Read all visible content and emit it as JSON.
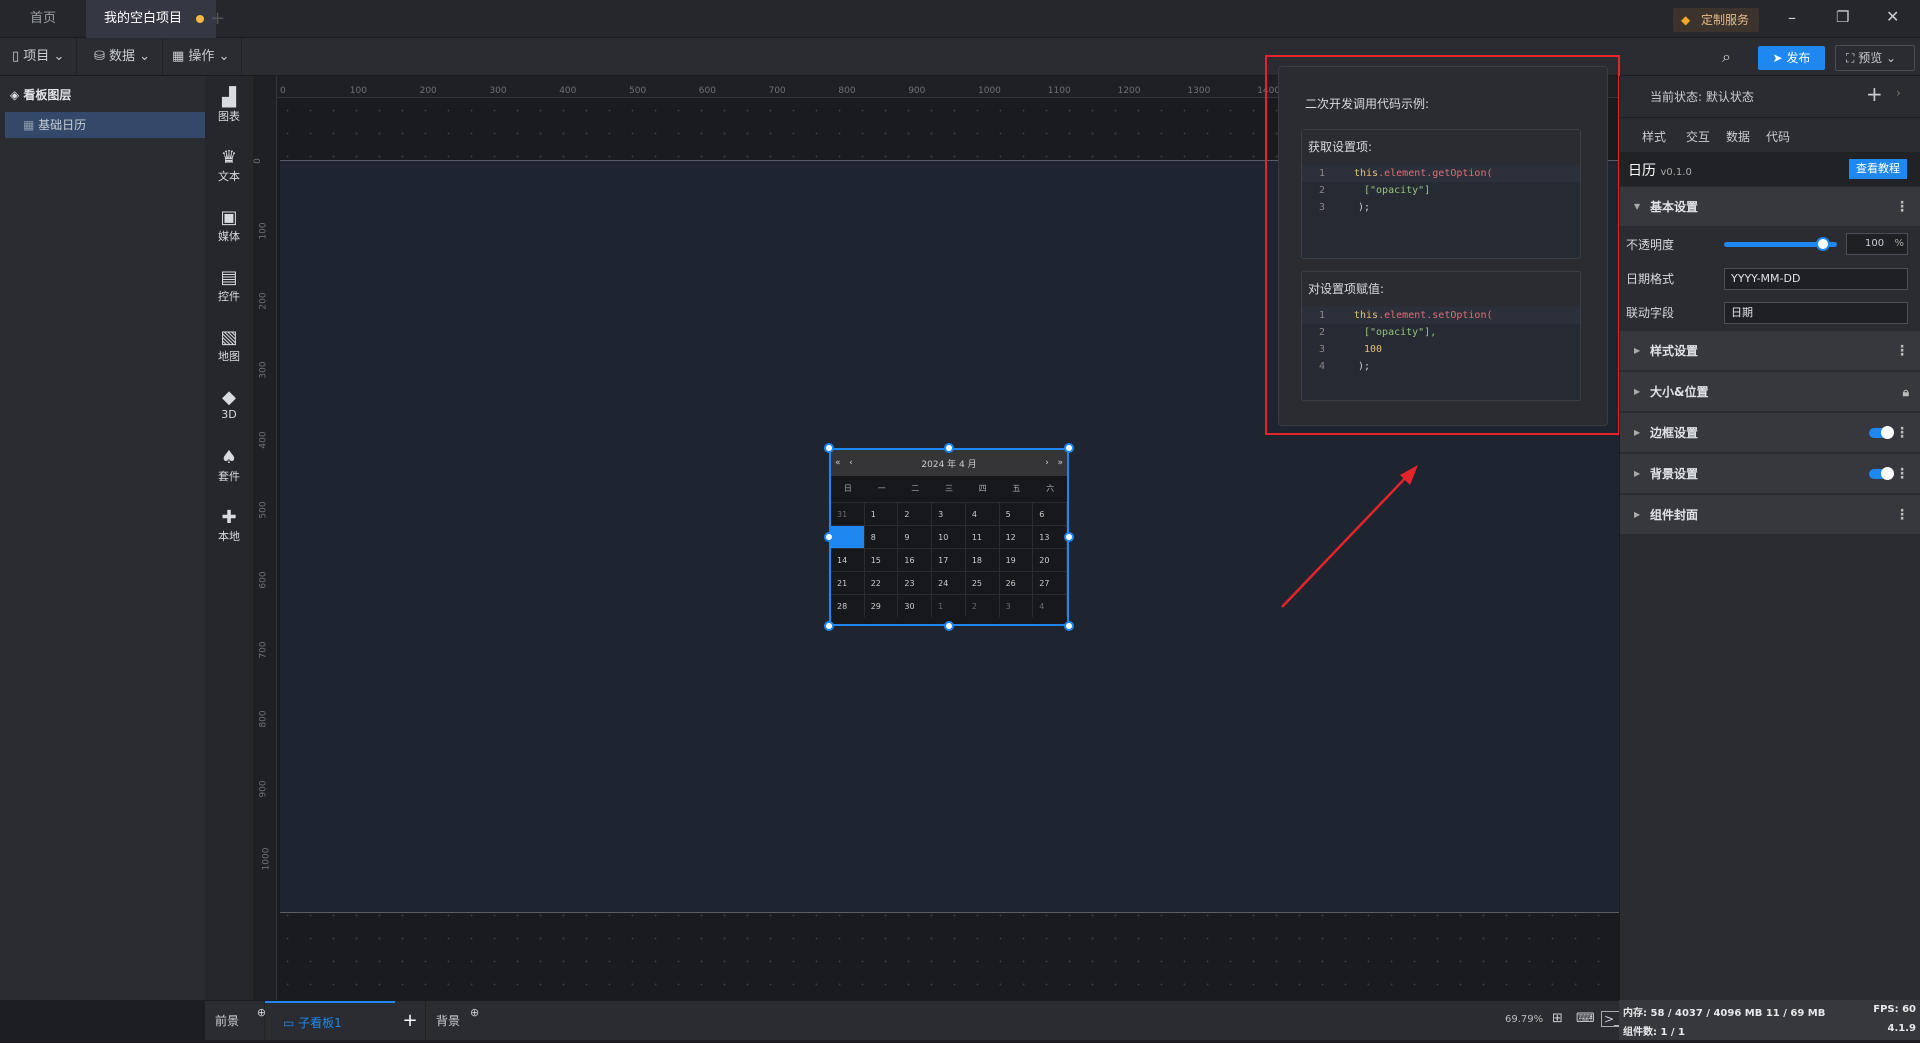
{
  "titlebar": {
    "tabs": [
      {
        "label": "首页"
      },
      {
        "label": "我的空白项目"
      }
    ],
    "new_tab": "+",
    "custom_service": "定制服务"
  },
  "toolbar": {
    "menus": [
      "项目",
      "数据",
      "操作"
    ],
    "publish": "发布",
    "preview": "预览"
  },
  "layers": {
    "title": "看板图层",
    "items": [
      "基础日历"
    ]
  },
  "iconbar": [
    {
      "label": "图表",
      "icon": "chart-icon"
    },
    {
      "label": "文本",
      "icon": "text-icon"
    },
    {
      "label": "媒体",
      "icon": "media-icon"
    },
    {
      "label": "控件",
      "icon": "control-icon"
    },
    {
      "label": "地图",
      "icon": "map-icon"
    },
    {
      "label": "3D",
      "icon": "cube-icon"
    },
    {
      "label": "套件",
      "icon": "kit-icon"
    },
    {
      "label": "本地",
      "icon": "puzzle-icon"
    }
  ],
  "ruler": {
    "top": [
      "0",
      "100",
      "200",
      "300",
      "400",
      "500",
      "600",
      "700",
      "800",
      "900",
      "1000",
      "1100",
      "1200",
      "1300",
      "1400"
    ],
    "left": [
      "0",
      "100",
      "200",
      "300",
      "400",
      "500",
      "600",
      "700",
      "800",
      "900",
      "1000"
    ]
  },
  "calendar": {
    "title": "2024 年 4 月",
    "weekdays": [
      "日",
      "一",
      "二",
      "三",
      "四",
      "五",
      "六"
    ],
    "days": [
      "31",
      "1",
      "2",
      "3",
      "4",
      "5",
      "6",
      "",
      "8",
      "9",
      "10",
      "11",
      "12",
      "13",
      "14",
      "15",
      "16",
      "17",
      "18",
      "19",
      "20",
      "21",
      "22",
      "23",
      "24",
      "25",
      "26",
      "27",
      "28",
      "29",
      "30",
      "1",
      "2",
      "3",
      "4"
    ]
  },
  "popover": {
    "title": "二次开发调用代码示例:",
    "get": {
      "title": "获取设置项:",
      "lines": [
        [
          "this",
          ".element.getOption("
        ],
        [
          "",
          "[\"opacity\"]"
        ],
        [
          "",
          ");"
        ]
      ]
    },
    "set": {
      "title": "对设置项赋值:",
      "lines": [
        [
          "this",
          ".element.setOption("
        ],
        [
          "",
          "[\"opacity\"],"
        ],
        [
          "",
          "100"
        ],
        [
          "",
          ");"
        ]
      ]
    }
  },
  "right": {
    "state_label": "当前状态:",
    "state_value": "默认状态",
    "tabs": [
      "样式",
      "交互",
      "数据",
      "代码"
    ],
    "component": "日历",
    "version": "v0.1.0",
    "tutorial": "查看教程",
    "basic": "基本设置",
    "opacity_label": "不透明度",
    "opacity_value": "100",
    "opacity_unit": "%",
    "opacity_fraction": 1.0,
    "date_format_label": "日期格式",
    "date_format": "YYYY-MM-DD",
    "link_field_label": "联动字段",
    "link_field": "日期",
    "sections": [
      "样式设置",
      "大小&位置",
      "边框设置",
      "背景设置",
      "组件封面"
    ]
  },
  "bottom": {
    "foreground": "前景",
    "subboard": "子看板1",
    "add": "+",
    "background": "背景",
    "zoom": "69.79%"
  },
  "status": {
    "memory": "内存: 58 / 4037 / 4096 MB  11 / 69 MB",
    "fps": "FPS:  60",
    "components": "组件数: 1 / 1",
    "version": "4.1.9"
  },
  "colors": {
    "accent": "#1e88f0",
    "highlight": "#e5232b"
  }
}
